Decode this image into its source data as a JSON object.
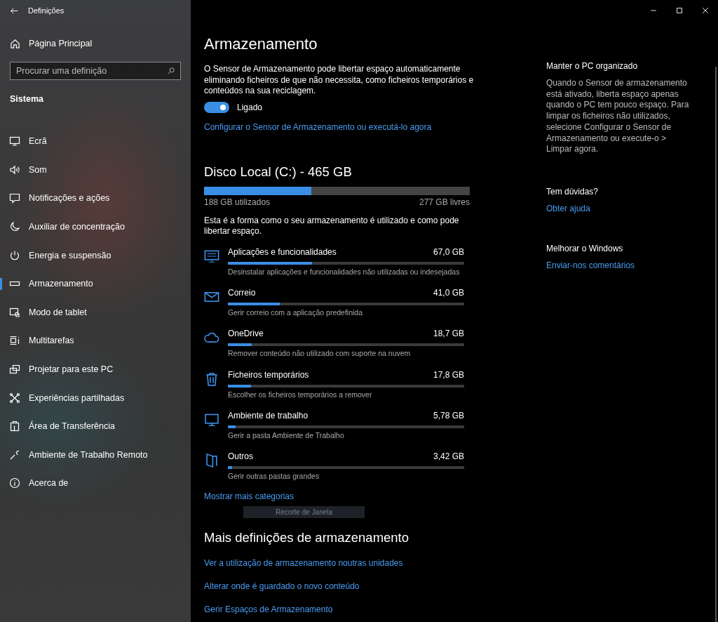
{
  "window": {
    "title": "Definições"
  },
  "sidebar": {
    "home": "Página Principal",
    "search": {
      "placeholder": "Procurar uma definição"
    },
    "section": "Sistema",
    "items": [
      {
        "label": "Ecrã",
        "selected": false
      },
      {
        "label": "Som",
        "selected": false
      },
      {
        "label": "Notificações e ações",
        "selected": false
      },
      {
        "label": "Auxiliar de concentração",
        "selected": false
      },
      {
        "label": "Energia e suspensão",
        "selected": false
      },
      {
        "label": "Armazenamento",
        "selected": true
      },
      {
        "label": "Modo de tablet",
        "selected": false
      },
      {
        "label": "Multitarefas",
        "selected": false
      },
      {
        "label": "Projetar para este PC",
        "selected": false
      },
      {
        "label": "Experiências partilhadas",
        "selected": false
      },
      {
        "label": "Área de Transferência",
        "selected": false
      },
      {
        "label": "Ambiente de Trabalho Remoto",
        "selected": false
      },
      {
        "label": "Acerca de",
        "selected": false
      }
    ]
  },
  "main": {
    "title": "Armazenamento",
    "description": "O Sensor de Armazenamento pode libertar espaço automaticamente eliminando ficheiros de que não necessita, como ficheiros temporários e conteúdos na sua reciclagem.",
    "toggle": {
      "on": true,
      "label": "Ligado"
    },
    "configure_link": "Configurar o Sensor de Armazenamento ou executá-lo agora",
    "disk": {
      "title": "Disco Local (C:) - 465 GB",
      "level": 0.405,
      "used": "188 GB utilizados",
      "free": "277 GB livres"
    },
    "usage_note": "Esta é a forma como o seu armazenamento é utilizado e como pode libertar espaço.",
    "categories": [
      {
        "name": "Aplicações e funcionalidades",
        "size": "67,0 GB",
        "level": 0.356,
        "hint": "Desinstalar aplicações e funcionalidades não utilizadas ou indesejadas"
      },
      {
        "name": "Correio",
        "size": "41,0 GB",
        "level": 0.22,
        "hint": "Gerir correio com a aplicação predefinida"
      },
      {
        "name": "OneDrive",
        "size": "18,7 GB",
        "level": 0.1,
        "hint": "Remover conteúdo não utilizado com suporte na nuvem"
      },
      {
        "name": "Ficheiros temporários",
        "size": "17,8 GB",
        "level": 0.097,
        "hint": "Escolher os ficheiros temporários a remover"
      },
      {
        "name": "Ambiente de trabalho",
        "size": "5,78 GB",
        "level": 0.033,
        "hint": "Gerir a pasta Ambiente de Trabalho"
      },
      {
        "name": "Outros",
        "size": "3,42 GB",
        "level": 0.018,
        "hint": "Gerir outras pastas grandes"
      }
    ],
    "more_link": "Mostrar mais categorias",
    "tooltip": "Recorte de Janela",
    "more_title": "Mais definições de armazenamento",
    "more_links": [
      "Ver a utilização de armazenamento noutras unidades",
      "Alterar onde é guardado o novo conteúdo",
      "Gerir Espaços de Armazenamento"
    ]
  },
  "related": [
    {
      "heading": "Manter o PC organizado",
      "text": "Quando o Sensor de armazenamento está ativado, liberta espaço apenas quando o PC tem pouco espaço. Para limpar os ficheiros não utilizados, selecione Configurar o Sensor de Armazenamento ou execute-o > Limpar agora."
    },
    {
      "heading": "Tem dúvidas?",
      "link": "Obter ajuda"
    },
    {
      "heading": "Melhorar o Windows",
      "link": "Enviar-nos comentários"
    }
  ]
}
